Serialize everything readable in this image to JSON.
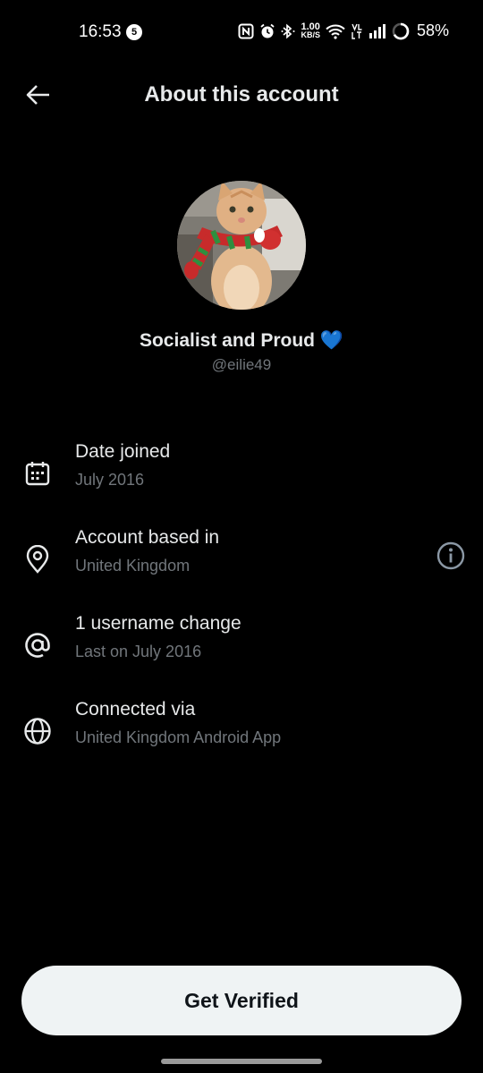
{
  "status_bar": {
    "time": "16:53",
    "notification_count": "5",
    "speed_value": "1.00",
    "speed_unit": "KB/S",
    "battery": "58%",
    "icons": [
      "nfc-icon",
      "alarm-icon",
      "bluetooth-icon",
      "wifi-icon",
      "volte-icon",
      "signal-icon",
      "battery-icon"
    ]
  },
  "header": {
    "title": "About this account",
    "back_icon": "arrow-left-icon"
  },
  "profile": {
    "display_name": "Socialist and Proud",
    "emoji": "💙",
    "username": "@eilie49"
  },
  "info": [
    {
      "icon": "calendar-icon",
      "title": "Date joined",
      "subtitle": "July 2016"
    },
    {
      "icon": "location-pin-icon",
      "title": "Account based in",
      "subtitle": "United Kingdom",
      "action_icon": "info-icon"
    },
    {
      "icon": "at-sign-icon",
      "title": "1 username change",
      "subtitle": "Last on July 2016"
    },
    {
      "icon": "globe-icon",
      "title": "Connected via",
      "subtitle": "United Kingdom Android App"
    }
  ],
  "footer": {
    "verify_label": "Get Verified"
  },
  "colors": {
    "background": "#000000",
    "primary_text": "#e7e9ea",
    "secondary_text": "#71767b",
    "button_bg": "#eff3f4",
    "button_text": "#0f1419"
  }
}
